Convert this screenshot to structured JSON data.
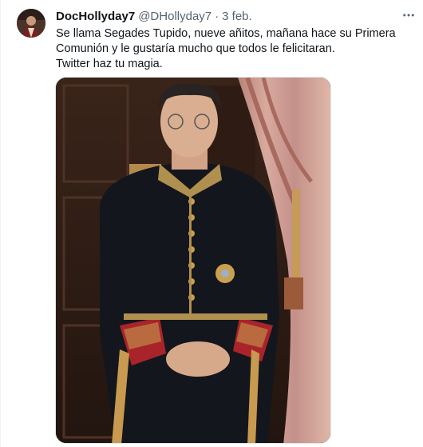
{
  "tweet": {
    "display_name": "DocHollyday7",
    "handle": "@DHollyday7",
    "separator": "·",
    "date": "3 feb.",
    "text_lines": [
      "Se llama Segades Tupido, nueve añitos, mañana hace su Primera",
      "Comunión y le gustaría mucho que todos le felicitaran.",
      "Twitter haz tu magia."
    ],
    "icons": {
      "avatar": "avatar-photo",
      "more": "more-options-icon"
    },
    "media": {
      "kind": "photo"
    }
  },
  "colors": {
    "text_primary": "#0f1419",
    "text_secondary": "#536471",
    "border": "#eff3f4"
  }
}
